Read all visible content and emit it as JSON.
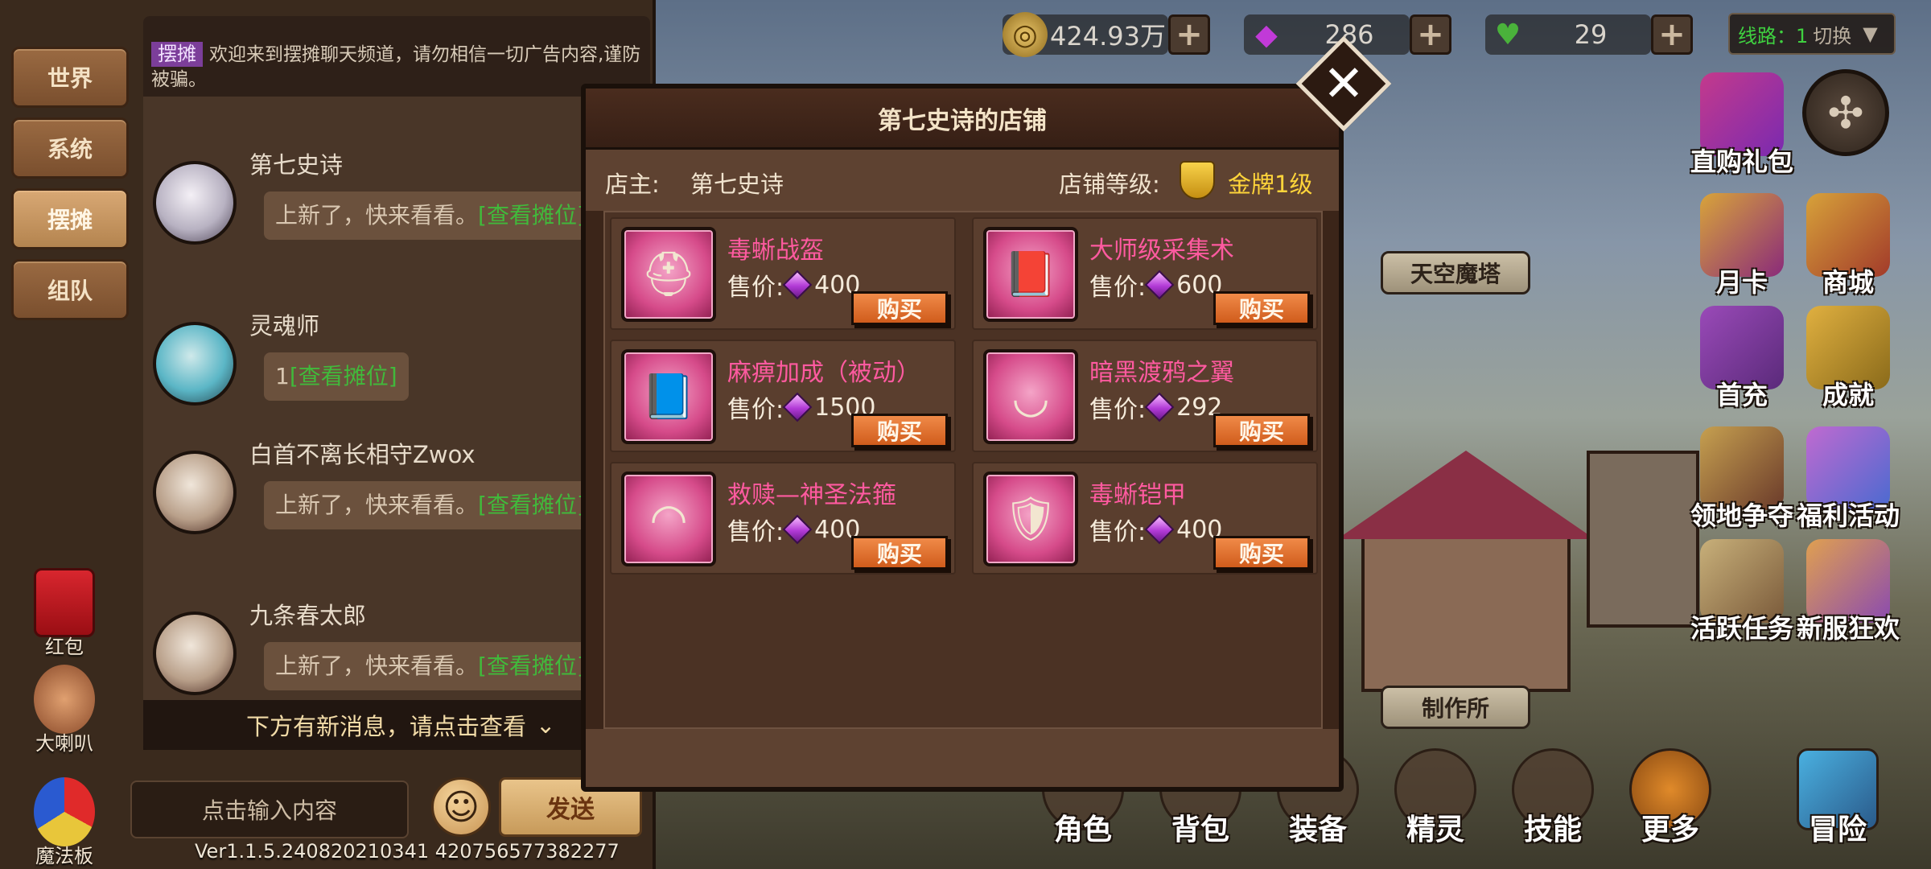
{
  "currency": {
    "gold": "424.93万",
    "gems": "286",
    "stamina": "29",
    "server_line_label": "线路：1",
    "switch_label": "切换"
  },
  "chat": {
    "tabs": [
      {
        "label": "世界"
      },
      {
        "label": "系统"
      },
      {
        "label": "摆摊"
      },
      {
        "label": "组队"
      }
    ],
    "notice_tag": "摆摊",
    "notice_text": "欢迎来到摆摊聊天频道，请勿相信一切广告内容,谨防被骗。",
    "messages": [
      {
        "name": "第七史诗",
        "text": "上新了，快来看看。",
        "link": "[查看摊位]"
      },
      {
        "name": "灵魂师",
        "text": "1",
        "link": "[查看摊位]"
      },
      {
        "name": "白首不离长相守Zwox",
        "text": "上新了，快来看看。",
        "link": "[查看摊位]"
      },
      {
        "name": "九条春太郎",
        "text": "上新了，快来看看。",
        "link": "[查看摊位]"
      }
    ],
    "new_message_hint": "下方有新消息，请点击查看",
    "input_placeholder": "点击输入内容",
    "send_label": "发送",
    "side": {
      "red_packet": "红包",
      "loudspeaker": "大喇叭",
      "magic_board": "魔法板"
    },
    "version": "Ver1.1.5.240820210341 420756577382277"
  },
  "shop": {
    "title": "第七史诗的店铺",
    "owner_label": "店主:",
    "owner_name": "第七史诗",
    "level_label": "店铺等级:",
    "level_value": "金牌1级",
    "price_label": "售价:",
    "buy_label": "购买",
    "items": [
      {
        "name": "毒蜥战盔",
        "price": "400",
        "icon": "helmet-icon"
      },
      {
        "name": "大师级采集术",
        "price": "600",
        "icon": "book-icon"
      },
      {
        "name": "麻痹加成（被动）",
        "price": "1500",
        "icon": "skill-book-icon"
      },
      {
        "name": "暗黑渡鸦之翼",
        "price": "292",
        "icon": "necklace-icon"
      },
      {
        "name": "救赎—神圣法箍",
        "price": "400",
        "icon": "circlet-icon"
      },
      {
        "name": "毒蜥铠甲",
        "price": "400",
        "icon": "armor-icon"
      }
    ]
  },
  "right_menu": {
    "direct_gift": "直购礼包",
    "monthly_card": "月卡",
    "store": "商城",
    "first_recharge": "首充",
    "achievement": "成就",
    "territory": "领地争夺",
    "welfare": "福利活动",
    "active_tasks": "活跃任务",
    "new_server": "新服狂欢",
    "sky_tower": "天空魔塔",
    "workshop": "制作所"
  },
  "bottom_nav": {
    "character": "角色",
    "bag": "背包",
    "equipment": "装备",
    "spirit": "精灵",
    "skill": "技能",
    "more": "更多",
    "adventure": "冒险"
  },
  "colors": {
    "item_name": "#ff5aa0",
    "link_green": "#41b93b",
    "gold_text": "#ffd53a",
    "buy_button": "#e4733a"
  }
}
